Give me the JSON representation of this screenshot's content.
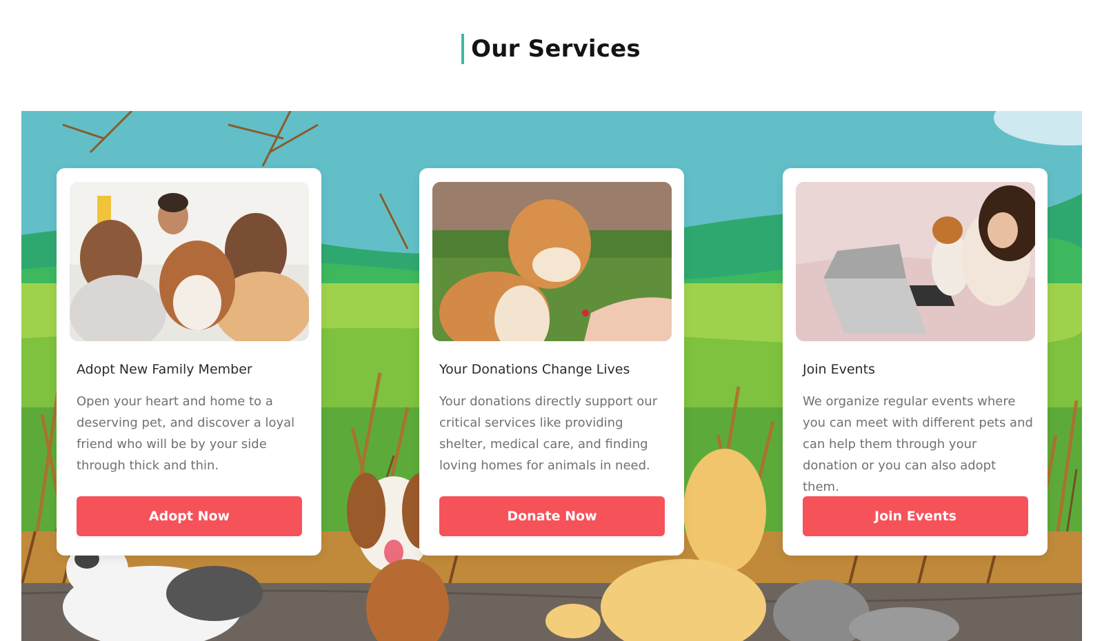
{
  "section": {
    "title": "Our Services"
  },
  "colors": {
    "accent_bar": "#3fb8a7",
    "button": "#f6525a",
    "sky": "#62bfc7",
    "grass": "#8fd14f"
  },
  "cards": [
    {
      "title": "Adopt New Family Member",
      "text": "Open your heart and home to a deserving pet, and discover a loyal friend who will be by your side through thick and thin.",
      "button": "Adopt Now",
      "photo_icon": "family-with-dog-photo"
    },
    {
      "title": "Your Donations Change Lives",
      "text": "Your donations directly support our critical services like providing shelter, medical care, and finding loving homes for animals in need.",
      "button": "Donate Now",
      "photo_icon": "shiba-paw-photo"
    },
    {
      "title": "Join Events",
      "text": "We organize regular events where you can meet with different pets and can help them through your donation or you can also adopt them.",
      "button": "Join Events",
      "photo_icon": "woman-with-puppy-photo"
    }
  ]
}
